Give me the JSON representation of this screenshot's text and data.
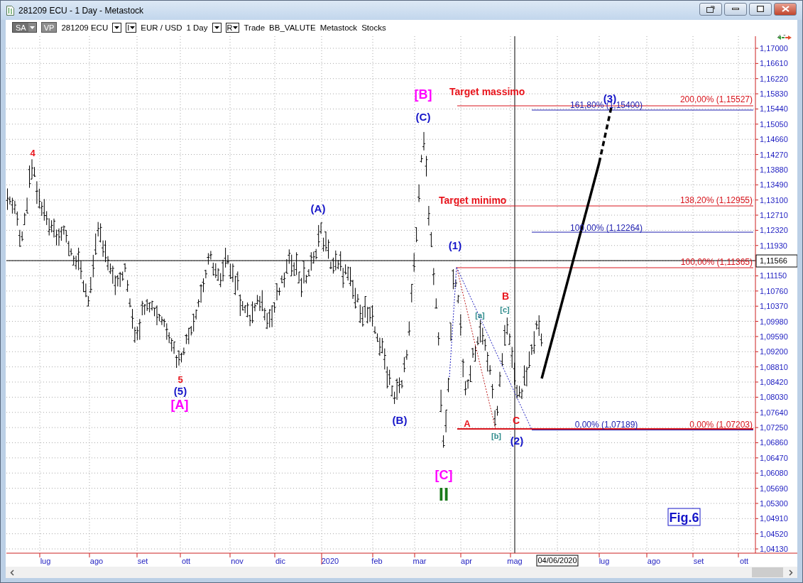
{
  "window": {
    "title": "281209 ECU - 1 Day - Metastock"
  },
  "toolbar": {
    "items": [
      {
        "kind": "dropdown-button",
        "label": "SA"
      },
      {
        "kind": "box",
        "label": "VP"
      },
      {
        "kind": "text",
        "label": "281209 ECU"
      },
      {
        "kind": "caret"
      },
      {
        "kind": "caret-box",
        "label": "I"
      },
      {
        "kind": "text",
        "label": "EUR / USD"
      },
      {
        "kind": "text",
        "label": "1 Day"
      },
      {
        "kind": "caret"
      },
      {
        "kind": "caret-box",
        "label": "R"
      },
      {
        "kind": "text",
        "label": "Trade"
      },
      {
        "kind": "text",
        "label": "BB_VALUTE"
      },
      {
        "kind": "text",
        "label": "Metastock"
      },
      {
        "kind": "text",
        "label": "Stocks"
      }
    ]
  },
  "chart": {
    "price_axis": [
      "1,17000",
      "1,16610",
      "1,16220",
      "1,15830",
      "1,15440",
      "1,15050",
      "1,14660",
      "1,14270",
      "1,13880",
      "1,13490",
      "1,13100",
      "1,12710",
      "1,12320",
      "1,11930",
      "1,11150",
      "1,10760",
      "1,10370",
      "1,09980",
      "1,09590",
      "1,09200",
      "1,08810",
      "1,08420",
      "1,08030",
      "1,07640",
      "1,07250",
      "1,06860",
      "1,06470",
      "1,06080",
      "1,05690",
      "1,05300",
      "1,04910",
      "1,04520",
      "1,04130"
    ],
    "current_price": "1,11566",
    "time_axis": [
      {
        "label": "lug",
        "kind": "month"
      },
      {
        "label": "ago",
        "kind": "month"
      },
      {
        "label": "set",
        "kind": "month"
      },
      {
        "label": "ott",
        "kind": "month"
      },
      {
        "label": "nov",
        "kind": "month"
      },
      {
        "label": "dic",
        "kind": "month"
      },
      {
        "label": "2020",
        "kind": "year"
      },
      {
        "label": "feb",
        "kind": "month"
      },
      {
        "label": "mar",
        "kind": "month"
      },
      {
        "label": "apr",
        "kind": "month"
      },
      {
        "label": "mag",
        "kind": "month"
      },
      {
        "label": "04/06/2020",
        "kind": "cursor"
      },
      {
        "label": "lug",
        "kind": "month"
      },
      {
        "label": "ago",
        "kind": "month"
      },
      {
        "label": "set",
        "kind": "month"
      },
      {
        "label": "ott",
        "kind": "month"
      }
    ],
    "fib_levels": [
      {
        "text": "200,00% (1,15527)",
        "color": "#d8141c"
      },
      {
        "text": "161,80% (1,15400)",
        "color": "#2020b0"
      },
      {
        "text": "138,20% (1,12955)",
        "color": "#d8141c"
      },
      {
        "text": "100,00% (1,12264)",
        "color": "#2020b0"
      },
      {
        "text": "100,00% (1,11365)",
        "color": "#d8141c"
      },
      {
        "text": "0,00% (1,07189)",
        "color": "#2020b0"
      },
      {
        "text": "0,00% (1,07203)",
        "color": "#d8141c"
      }
    ],
    "targets": [
      {
        "text": "Target massimo"
      },
      {
        "text": "Target minimo"
      }
    ],
    "wave_labels": [
      {
        "text": "4",
        "color": "#e8141c"
      },
      {
        "text": "5",
        "color": "#e8141c"
      },
      {
        "text": "(5)",
        "color": "#1414c8"
      },
      {
        "text": "[A]",
        "color": "#ff00ff"
      },
      {
        "text": "(A)",
        "color": "#1414c8"
      },
      {
        "text": "(B)",
        "color": "#1414c8"
      },
      {
        "text": "[B]",
        "color": "#ff00ff"
      },
      {
        "text": "(C)",
        "color": "#1414c8"
      },
      {
        "text": "[C]",
        "color": "#ff00ff"
      },
      {
        "text": "II",
        "color": "#1a7a1a"
      },
      {
        "text": "(1)",
        "color": "#1414c8"
      },
      {
        "text": "A",
        "color": "#e8141c"
      },
      {
        "text": "[a]",
        "color": "#2e8b8b"
      },
      {
        "text": "[b]",
        "color": "#2e8b8b"
      },
      {
        "text": "B",
        "color": "#e8141c"
      },
      {
        "text": "[c]",
        "color": "#2e8b8b"
      },
      {
        "text": "C",
        "color": "#e8141c"
      },
      {
        "text": "(2)",
        "color": "#1414c8"
      },
      {
        "text": "(3)",
        "color": "#1414c8"
      }
    ],
    "figure_label": "Fig.6"
  }
}
